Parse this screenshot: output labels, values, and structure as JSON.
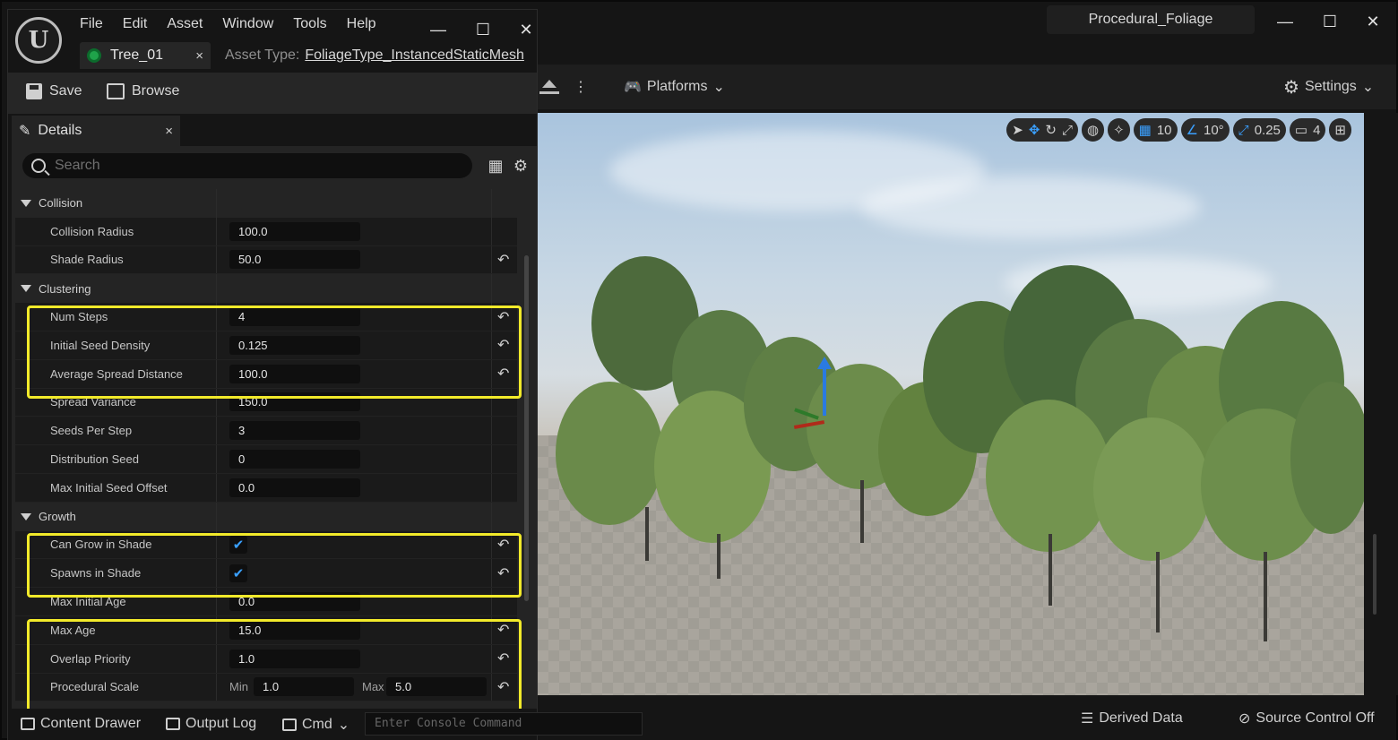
{
  "main_editor": {
    "title": "Procedural_Foliage",
    "window_controls": {
      "minimize": "—",
      "maximize": "☐",
      "close": "✕"
    },
    "toolbar": {
      "platforms_label": "Platforms",
      "settings_label": "Settings"
    },
    "viewport_tools": {
      "grid_snap": "10",
      "rotation_snap": "10°",
      "scale_snap": "0.25",
      "camera_speed": "4"
    },
    "status": {
      "derived_data": "Derived Data",
      "source_control": "Source Control Off"
    }
  },
  "asset_editor": {
    "logo": "U",
    "menu": [
      "File",
      "Edit",
      "Asset",
      "Window",
      "Tools",
      "Help"
    ],
    "window_controls": {
      "minimize": "—",
      "maximize": "☐",
      "close": "✕"
    },
    "document_tab": {
      "label": "Tree_01",
      "close": "×"
    },
    "asset_type": {
      "label": "Asset Type:",
      "value": "FoliageType_InstancedStaticMesh"
    },
    "toolbar": {
      "save_label": "Save",
      "browse_label": "Browse"
    },
    "details_tab": {
      "label": "Details",
      "close": "×"
    },
    "search": {
      "placeholder": "Search"
    },
    "properties": {
      "collision": {
        "title": "Collision",
        "collision_radius": {
          "label": "Collision Radius",
          "value": "100.0"
        },
        "shade_radius": {
          "label": "Shade Radius",
          "value": "50.0"
        }
      },
      "clustering": {
        "title": "Clustering",
        "num_steps": {
          "label": "Num Steps",
          "value": "4"
        },
        "initial_seed_density": {
          "label": "Initial Seed Density",
          "value": "0.125"
        },
        "average_spread_distance": {
          "label": "Average Spread Distance",
          "value": "100.0"
        },
        "spread_variance": {
          "label": "Spread Variance",
          "value": "150.0"
        },
        "seeds_per_step": {
          "label": "Seeds Per Step",
          "value": "3"
        },
        "distribution_seed": {
          "label": "Distribution Seed",
          "value": "0"
        },
        "max_initial_seed_offset": {
          "label": "Max Initial Seed Offset",
          "value": "0.0"
        }
      },
      "growth": {
        "title": "Growth",
        "can_grow_in_shade": {
          "label": "Can Grow in Shade",
          "checked": true
        },
        "spawns_in_shade": {
          "label": "Spawns in Shade",
          "checked": true
        },
        "max_initial_age": {
          "label": "Max Initial Age",
          "value": "0.0"
        },
        "max_age": {
          "label": "Max Age",
          "value": "15.0"
        },
        "overlap_priority": {
          "label": "Overlap Priority",
          "value": "1.0"
        },
        "procedural_scale": {
          "label": "Procedural Scale",
          "min_label": "Min",
          "min_value": "1.0",
          "max_label": "Max",
          "max_value": "5.0"
        }
      }
    },
    "status": {
      "content_drawer": "Content Drawer",
      "output_log": "Output Log",
      "cmd": "Cmd",
      "console_placeholder": "Enter Console Command"
    }
  },
  "colors": {
    "highlight": "#f2ea2a",
    "accent_blue": "#3aa0ff",
    "panel": "#242424"
  }
}
